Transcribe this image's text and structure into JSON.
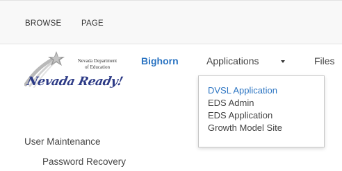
{
  "ribbon": {
    "tabs": [
      "BROWSE",
      "PAGE"
    ]
  },
  "logo": {
    "department_line1": "Nevada Department",
    "department_line2": "of Education",
    "script": "Nevada Ready!"
  },
  "topnav": {
    "items": [
      {
        "label": "Bighorn",
        "active": true
      },
      {
        "label": "Applications",
        "active": false
      },
      {
        "label": "Files",
        "active": false
      }
    ]
  },
  "dropdown": {
    "items": [
      {
        "label": "DVSL Application",
        "highlighted": true
      },
      {
        "label": "EDS Admin",
        "highlighted": false
      },
      {
        "label": "EDS Application",
        "highlighted": false
      },
      {
        "label": "Growth Model Site",
        "highlighted": false
      }
    ]
  },
  "quicklaunch": {
    "heading": "User Maintenance",
    "items": [
      "Password Recovery"
    ]
  },
  "colors": {
    "accent": "#2b74c2",
    "text": "#444444",
    "ribbon_bg": "#f8f8f8",
    "logo_script": "#2c3a86"
  },
  "icons": {
    "logo_star": "star-icon",
    "applications_menu": "caret-down-icon"
  }
}
